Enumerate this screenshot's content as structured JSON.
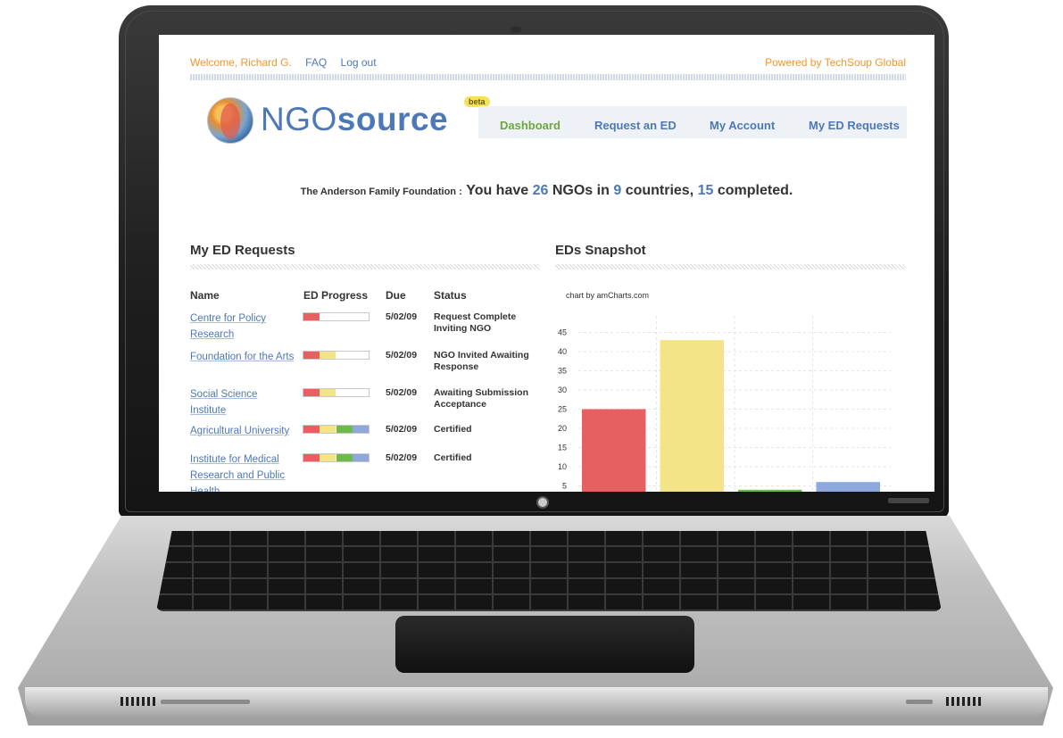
{
  "header": {
    "welcome": "Welcome, Richard G.",
    "faq": "FAQ",
    "logout": "Log out",
    "powered": "Powered by TechSoup Global"
  },
  "logo": {
    "ngo": "NGO",
    "source": "source",
    "beta": "beta"
  },
  "nav": {
    "items": [
      "Dashboard",
      "Request an ED",
      "My Account",
      "My ED Requests"
    ],
    "active": "Dashboard",
    "active_color": "#6aa83b",
    "link_color": "#4d78b7"
  },
  "summary": {
    "org": "The Anderson Family Foundation :",
    "you_have": "You have",
    "ngo_count": "26",
    "ngos_in": "NGOs in",
    "country_count": "9",
    "countries": "countries,",
    "completed_count": "15",
    "completed": "completed."
  },
  "requests": {
    "title": "My ED Requests",
    "columns": [
      "Name",
      "ED Progress",
      "Due",
      "Status"
    ],
    "rows": [
      {
        "name": "Centre for Policy Research",
        "progress_steps": 1,
        "due": "5/02/09",
        "status": "Request Complete Inviting NGO"
      },
      {
        "name": "Foundation for the Arts",
        "progress_steps": 2,
        "due": "5/02/09",
        "status": "NGO Invited Awaiting Response"
      },
      {
        "name": "Social Science Institute",
        "progress_steps": 2,
        "due": "5/02/09",
        "status": "Awaiting Submission Acceptance"
      },
      {
        "name": "Agricultural University",
        "progress_steps": 4,
        "due": "5/02/09",
        "status": "Certified"
      },
      {
        "name": "Institute for Medical Research and Public Health",
        "progress_steps": 4,
        "due": "5/02/09",
        "status": "Certified"
      }
    ],
    "step_colors": [
      "#e85f61",
      "#f3e487",
      "#6dbb47",
      "#8ea7dc"
    ]
  },
  "snapshot": {
    "title": "EDs Snapshot",
    "credit": "chart by amCharts.com"
  },
  "chart_data": {
    "type": "bar",
    "categories": [
      "",
      "",
      "",
      ""
    ],
    "values": [
      25,
      43,
      4,
      6
    ],
    "colors": [
      "#e85f61",
      "#f3e487",
      "#6dbb47",
      "#8ea7dc"
    ],
    "yticks": [
      5,
      10,
      15,
      20,
      25,
      30,
      35,
      40,
      45
    ],
    "grid": true
  }
}
